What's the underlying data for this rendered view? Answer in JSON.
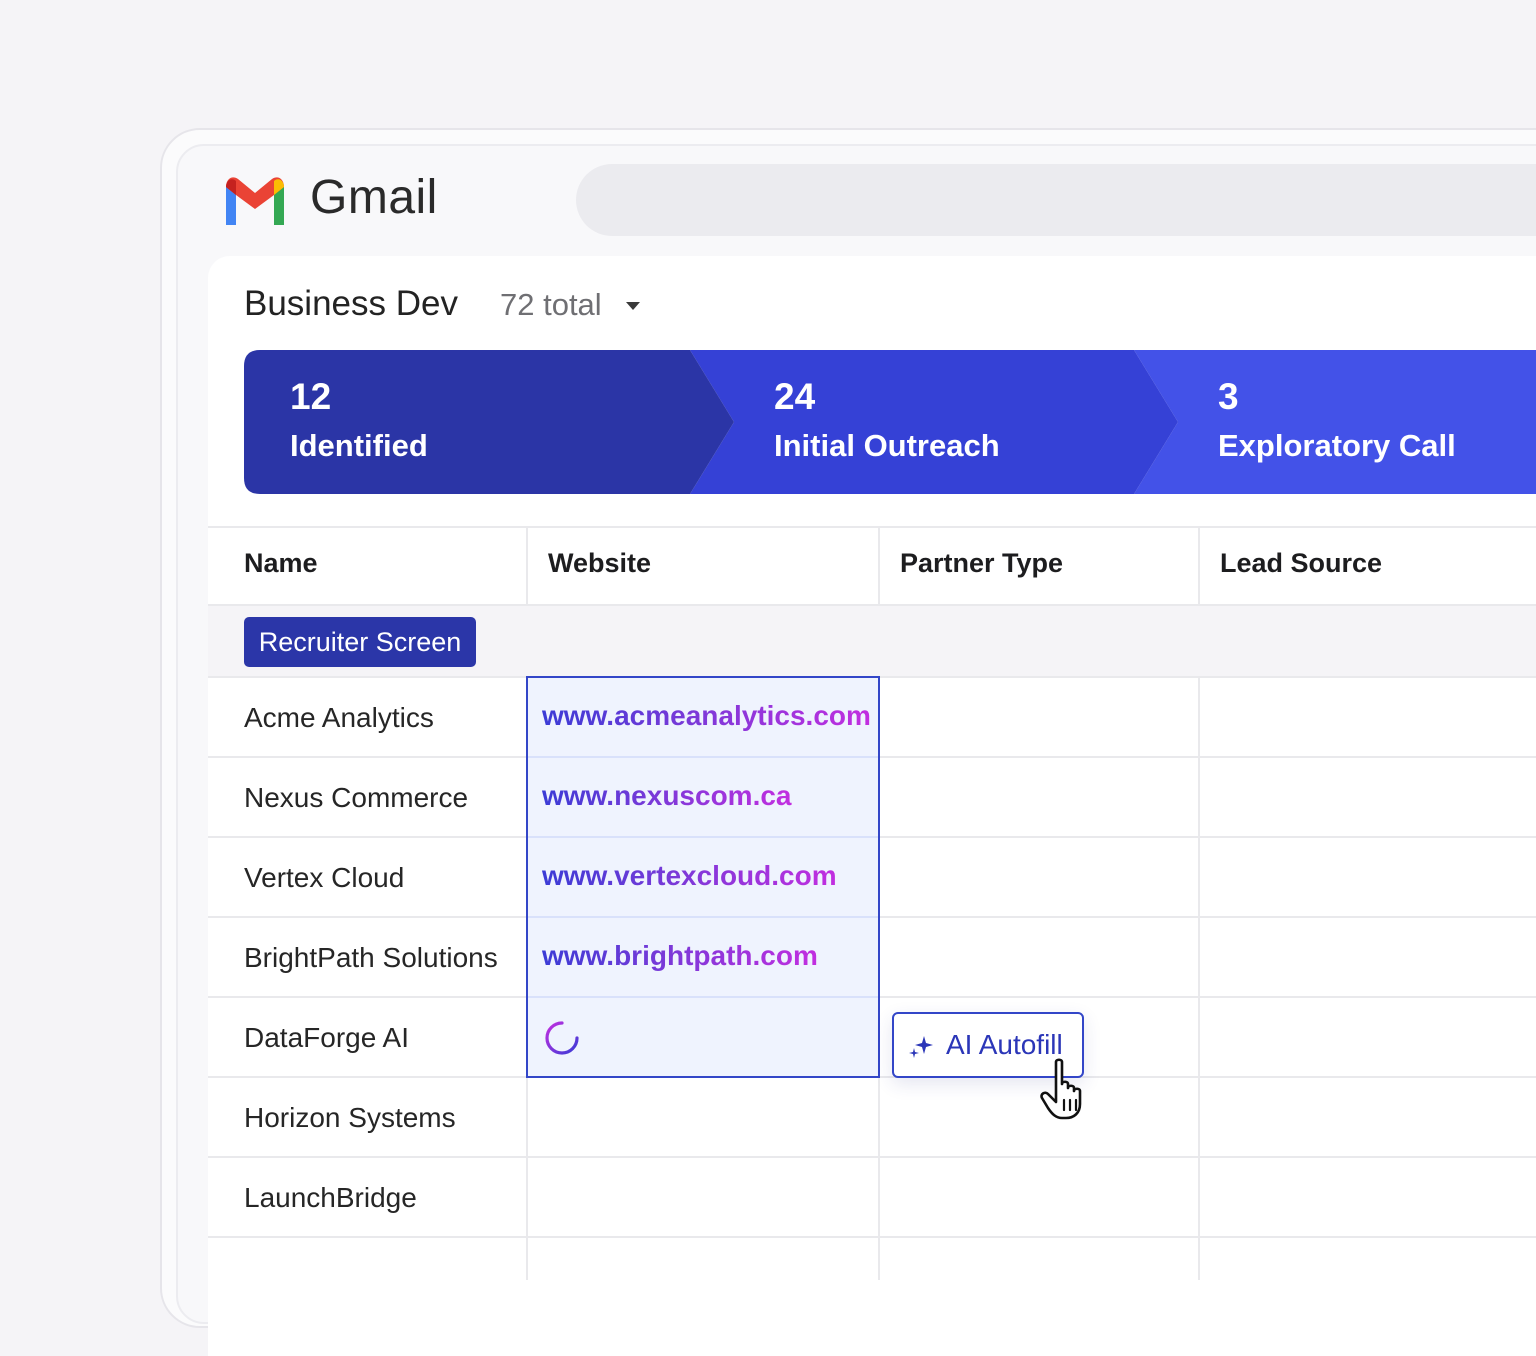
{
  "app": {
    "name": "Gmail"
  },
  "list": {
    "title": "Business Dev",
    "count_label": "72 total"
  },
  "pipeline": {
    "stages": [
      {
        "count": "12",
        "label": "Identified",
        "color": "#2b35a6"
      },
      {
        "count": "24",
        "label": "Initial Outreach",
        "color": "#3541d6"
      },
      {
        "count": "3",
        "label": "Exploratory Call",
        "color": "#4352e8"
      }
    ]
  },
  "table": {
    "columns": [
      "Name",
      "Website",
      "Partner Type",
      "Lead Source"
    ],
    "group_label": "Recruiter Screen",
    "rows": [
      {
        "name": "Acme Analytics",
        "website": "www.acmeanalytics.com"
      },
      {
        "name": "Nexus Commerce",
        "website": "www.nexuscom.ca"
      },
      {
        "name": "Vertex Cloud",
        "website": "www.vertexcloud.com"
      },
      {
        "name": "BrightPath Solutions",
        "website": "www.brightpath.com"
      },
      {
        "name": "DataForge AI",
        "website": ""
      },
      {
        "name": "Horizon Systems",
        "website": ""
      },
      {
        "name": "LaunchBridge",
        "website": ""
      }
    ]
  },
  "autofill": {
    "label": "AI Autofill",
    "icon": "sparkle-icon"
  },
  "colors": {
    "accent": "#3346c8",
    "selection_bg": "#eff3fe"
  }
}
